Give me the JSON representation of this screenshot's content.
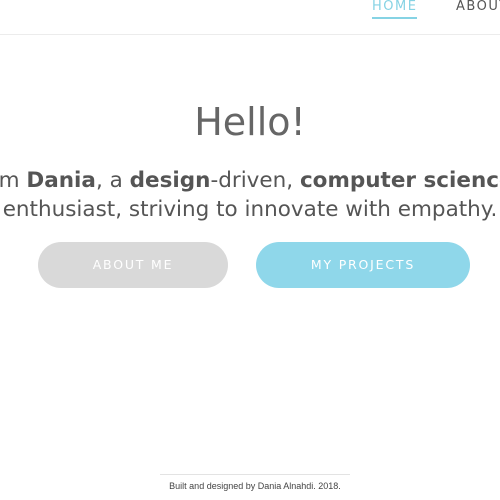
{
  "nav": {
    "home_label": "HOME",
    "about_label": "ABOUT"
  },
  "hero": {
    "greeting": "Hello!",
    "intro_line1": {
      "p1": "I'm ",
      "name": "Dania",
      "p2": ", a ",
      "design": "design",
      "p3": "-driven, ",
      "cs": "computer science"
    },
    "intro_line2": "enthusiast, striving to innovate with empathy."
  },
  "buttons": {
    "about_me": "ABOUT ME",
    "my_projects": "MY PROJECTS"
  },
  "footer": {
    "text": "Built and designed by Dania Alnahdi. 2018."
  },
  "colors": {
    "accent": "#86d3e4",
    "button_primary": "#8fd7ea",
    "button_secondary": "#d9d9d9",
    "text": "#555555"
  }
}
